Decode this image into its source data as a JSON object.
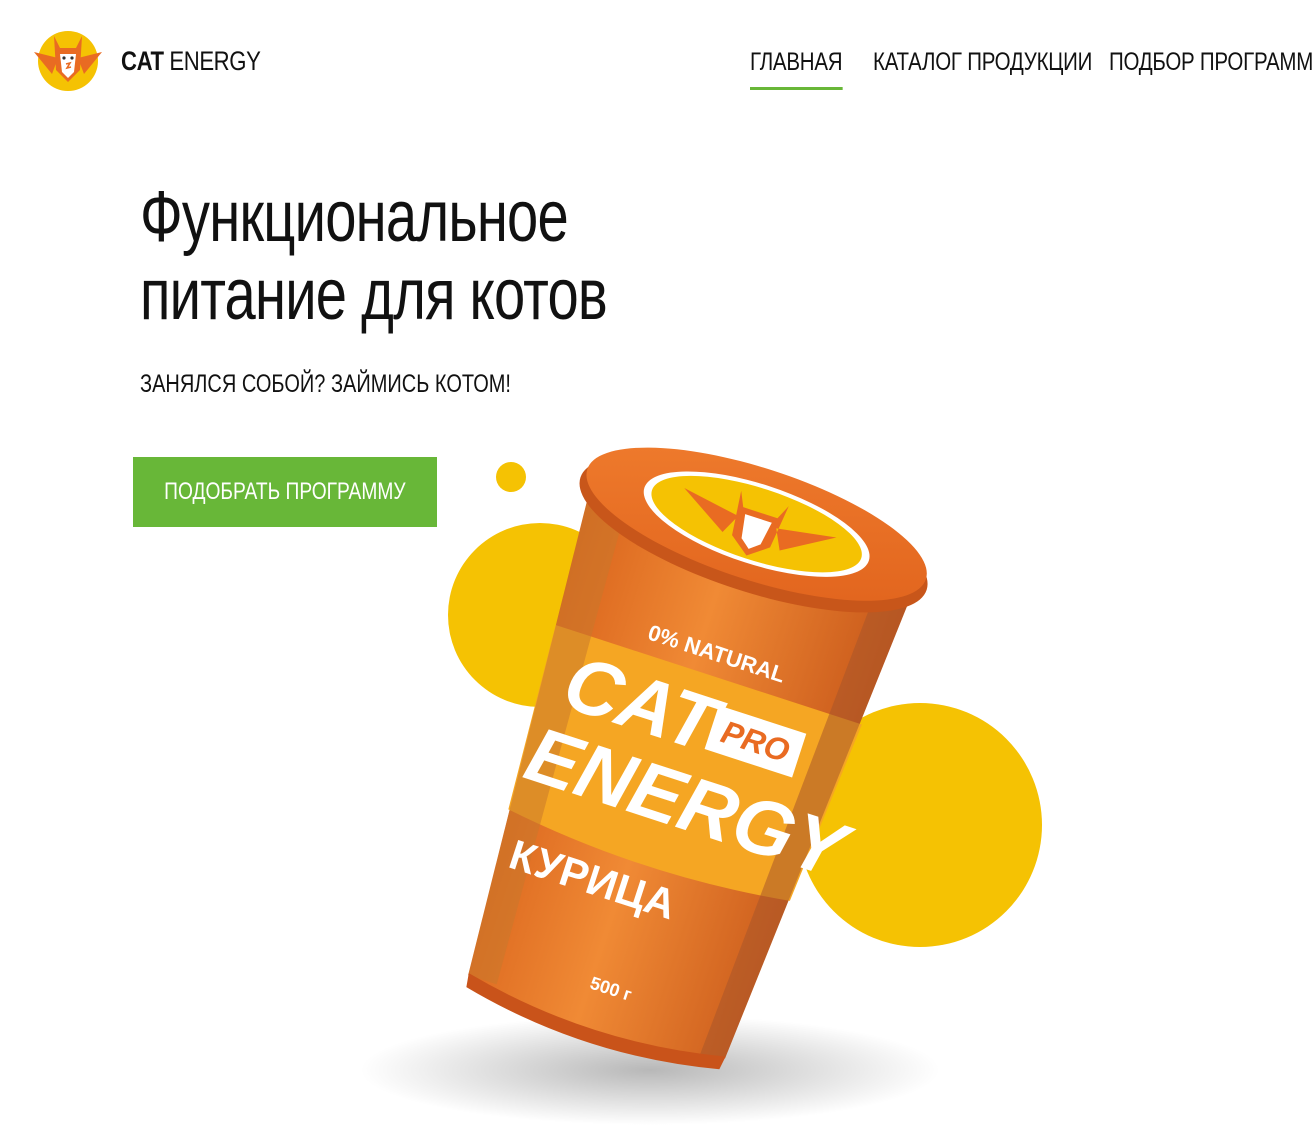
{
  "brand": {
    "name_bold": "CAT",
    "name_light": "ENERGY"
  },
  "nav": {
    "items": [
      {
        "label": "ГЛАВНАЯ",
        "active": true
      },
      {
        "label": "КАТАЛОГ ПРОДУКЦИИ",
        "active": false
      },
      {
        "label": "ПОДБОР ПРОГРАММЫ",
        "active": false
      }
    ]
  },
  "hero": {
    "title_line1": "Функциональное",
    "title_line2": "питание для котов",
    "subtitle": "ЗАНЯЛСЯ СОБОЙ? ЗАЙМИСЬ КОТОМ!",
    "cta_label": "ПОДОБРАТЬ ПРОГРАММУ"
  },
  "product": {
    "badge": "0% NATURAL",
    "brand_line1": "CAT",
    "brand_line2": "ENERGY",
    "tag": "PRO",
    "flavor": "КУРИЦА",
    "weight": "500 г"
  },
  "colors": {
    "accent": "#68b738",
    "orange": "#e96b22",
    "yellow": "#f5c203",
    "text": "#111111"
  }
}
